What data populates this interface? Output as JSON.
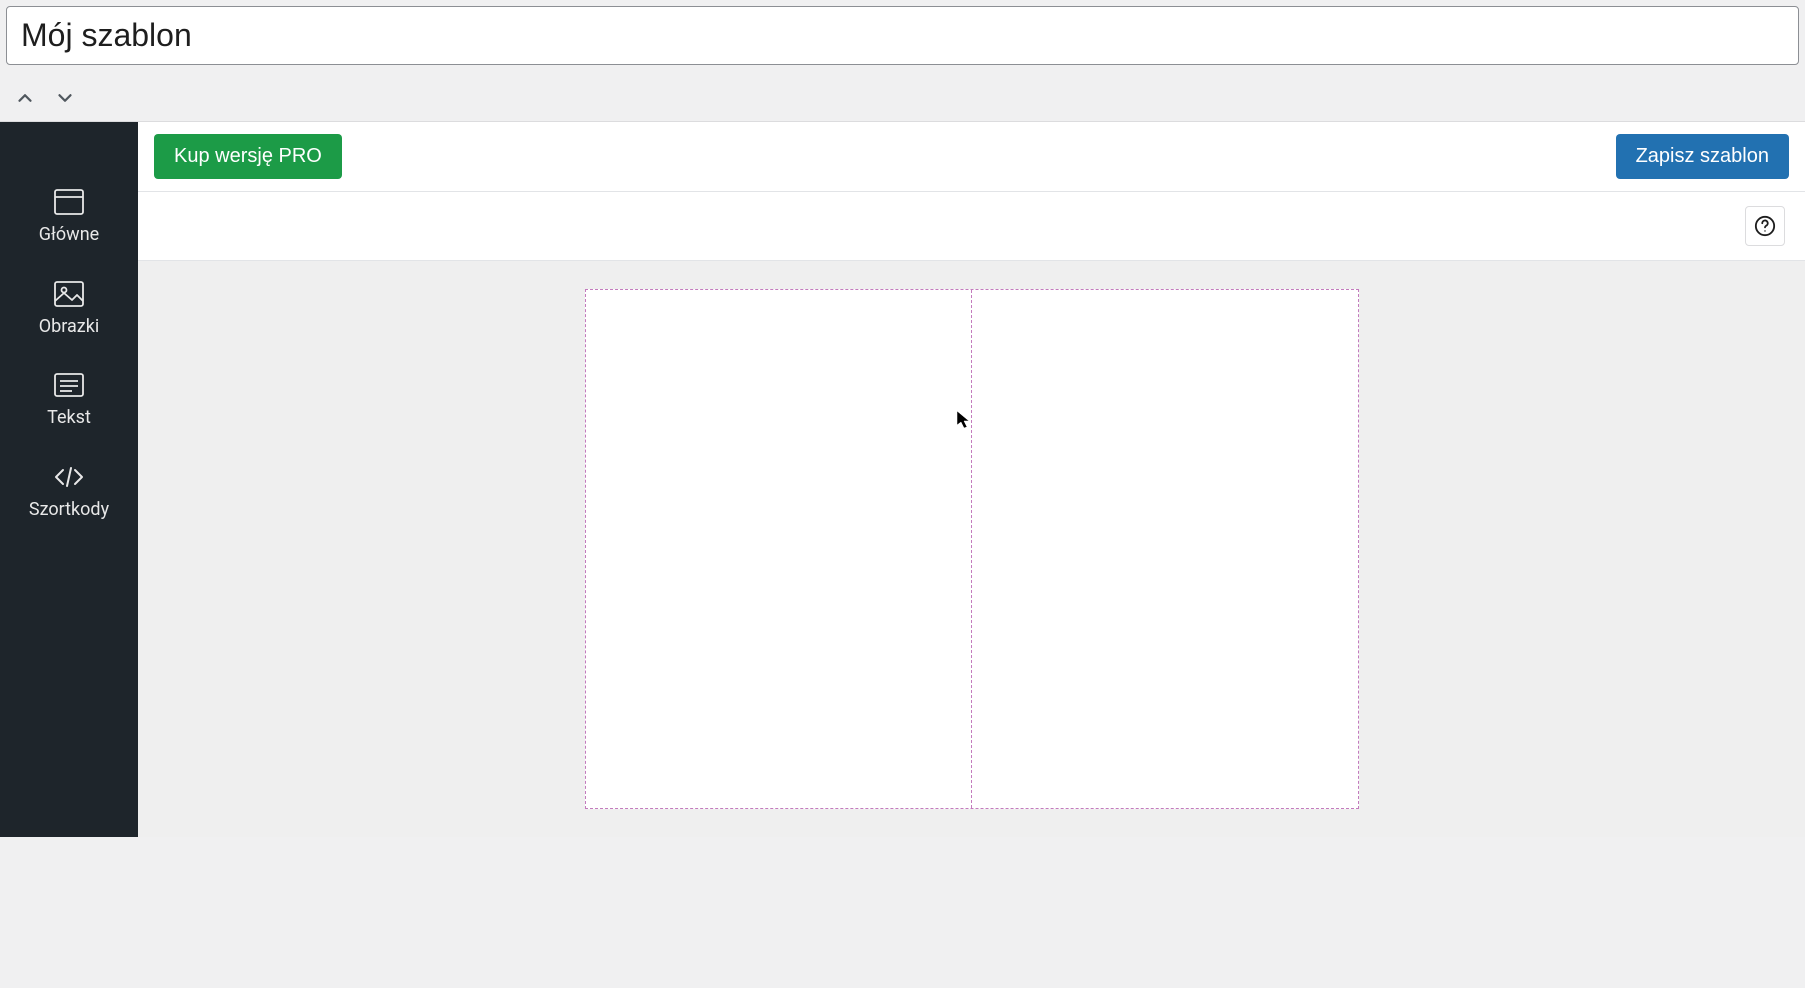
{
  "title": "Mój szablon",
  "sidebar": {
    "items": [
      {
        "label": "Główne",
        "icon": "window"
      },
      {
        "label": "Obrazki",
        "icon": "image"
      },
      {
        "label": "Tekst",
        "icon": "text"
      },
      {
        "label": "Szortkody",
        "icon": "code"
      }
    ]
  },
  "topbar": {
    "buy_pro_label": "Kup wersję PRO",
    "save_label": "Zapisz szablon"
  },
  "colors": {
    "sidebar_bg": "#1e252b",
    "btn_green": "#1c9b47",
    "btn_blue": "#2271b1",
    "dash_border": "#c37bbd"
  }
}
